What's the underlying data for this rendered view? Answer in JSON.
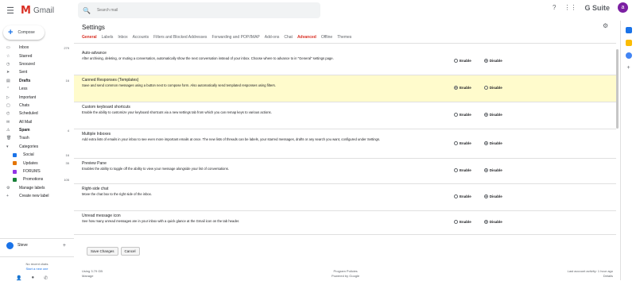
{
  "app": {
    "logo": "M",
    "name": "Gmail"
  },
  "search": {
    "placeholder": "Search mail"
  },
  "topbar": {
    "suite": "G Suite",
    "avatar_initial": "a"
  },
  "compose": {
    "label": "Compose"
  },
  "nav": [
    {
      "label": "Inbox",
      "icon": "inbox-icon",
      "glyph": "▭",
      "count": "279",
      "bold": false
    },
    {
      "label": "Starred",
      "icon": "star-icon",
      "glyph": "☆",
      "count": "",
      "bold": false
    },
    {
      "label": "Snoozed",
      "icon": "clock-icon",
      "glyph": "◷",
      "count": "",
      "bold": false
    },
    {
      "label": "Sent",
      "icon": "send-icon",
      "glyph": "➤",
      "count": "",
      "bold": false
    },
    {
      "label": "Drafts",
      "icon": "draft-icon",
      "glyph": "▤",
      "count": "16",
      "bold": true
    },
    {
      "label": "Less",
      "icon": "chevron-up-icon",
      "glyph": "⌃",
      "count": "",
      "bold": false
    },
    {
      "label": "Important",
      "icon": "important-icon",
      "glyph": "▷",
      "count": "",
      "bold": false
    },
    {
      "label": "Chats",
      "icon": "chat-icon",
      "glyph": "▢",
      "count": "",
      "bold": false
    },
    {
      "label": "Scheduled",
      "icon": "schedule-icon",
      "glyph": "◴",
      "count": "",
      "bold": false
    },
    {
      "label": "All Mail",
      "icon": "mail-icon",
      "glyph": "✉",
      "count": "",
      "bold": false
    },
    {
      "label": "Spam",
      "icon": "spam-icon",
      "glyph": "⚠",
      "count": "4",
      "bold": true
    },
    {
      "label": "Trash",
      "icon": "trash-icon",
      "glyph": "🗑",
      "count": "",
      "bold": false
    },
    {
      "label": "Categories",
      "icon": "label-icon",
      "glyph": "▾",
      "count": "",
      "bold": false
    }
  ],
  "categories": [
    {
      "label": "Social",
      "color": "#1a73e8",
      "count": "16"
    },
    {
      "label": "Updates",
      "color": "#e37400",
      "count": "35"
    },
    {
      "label": "FORUMS",
      "color": "#9334e6",
      "count": ""
    },
    {
      "label": "Promotions",
      "color": "#188038",
      "count": "105"
    }
  ],
  "nav_footer": [
    {
      "label": "Manage labels",
      "icon": "gear-icon",
      "glyph": "⚙"
    },
    {
      "label": "Create new label",
      "icon": "plus-icon",
      "glyph": "+"
    }
  ],
  "hangouts": {
    "user": "Steve",
    "message": "No recent chats",
    "link": "Start a new one"
  },
  "settings": {
    "title": "Settings"
  },
  "tabs": [
    {
      "label": "General",
      "active": true
    },
    {
      "label": "Labels",
      "active": false
    },
    {
      "label": "Inbox",
      "active": false
    },
    {
      "label": "Accounts",
      "active": false
    },
    {
      "label": "Filters and Blocked Addresses",
      "active": false
    },
    {
      "label": "Forwarding and POP/IMAP",
      "active": false
    },
    {
      "label": "Add-ons",
      "active": false
    },
    {
      "label": "Chat",
      "active": false
    },
    {
      "label": "Advanced",
      "active": true
    },
    {
      "label": "Offline",
      "active": false
    },
    {
      "label": "Themes",
      "active": false
    }
  ],
  "rows": [
    {
      "name": "Auto-advance",
      "desc": "After archiving, deleting, or muting a conversation, automatically show the next conversation instead of your inbox. Choose where to advance to in \"General\" settings page.",
      "enable": "Enable",
      "disable": "Disable",
      "selected": "disable",
      "highlight": false,
      "height": 34
    },
    {
      "name": "Canned Responses (Templates)",
      "desc": "Save and send common messages using a button next to compose form. Also automatically send templated responses using filters.",
      "enable": "Enable",
      "disable": "Disable",
      "selected": "enable",
      "highlight": true,
      "height": 34
    },
    {
      "name": "Custom keyboard shortcuts",
      "desc": "Enable the ability to customize your keyboard shortcuts via a new settings tab from which you can remap keys to various actions.",
      "enable": "Enable",
      "disable": "Disable",
      "selected": "disable",
      "highlight": false,
      "height": 34
    },
    {
      "name": "Multiple Inboxes",
      "desc": "Add extra lists of emails in your inbox to see even more important emails at once. The new lists of threads can be labels, your starred messages, drafts or any search you want, configured under Settings.",
      "enable": "Enable",
      "disable": "Disable",
      "selected": "disable",
      "highlight": false,
      "height": 37
    },
    {
      "name": "Preview Pane",
      "desc": "Enables the ability to toggle off the ability to view your message alongside your list of conversations.",
      "enable": "Enable",
      "disable": "Disable",
      "selected": "disable",
      "highlight": false,
      "height": 32
    },
    {
      "name": "Right-side chat",
      "desc": "Move the chat box to the right side of the inbox.",
      "enable": "Enable",
      "disable": "Disable",
      "selected": "disable",
      "highlight": false,
      "height": 34
    },
    {
      "name": "Unread message icon",
      "desc": "See how many unread messages are in your inbox with a quick glance at the Gmail icon on the tab header.",
      "enable": "Enable",
      "disable": "Disable",
      "selected": "disable",
      "highlight": false,
      "height": 30
    }
  ],
  "buttons": {
    "save": "Save Changes",
    "cancel": "Cancel"
  },
  "footer": {
    "left1": "Using 3.79 GB",
    "left2": "Manage",
    "center1": "Program Policies",
    "center2": "Powered by Google",
    "right1": "Last account activity: 1 hour ago",
    "right2": "Details"
  },
  "colors": {
    "accent": "#d93025",
    "highlight": "#fffbcc",
    "blue": "#1a73e8"
  }
}
